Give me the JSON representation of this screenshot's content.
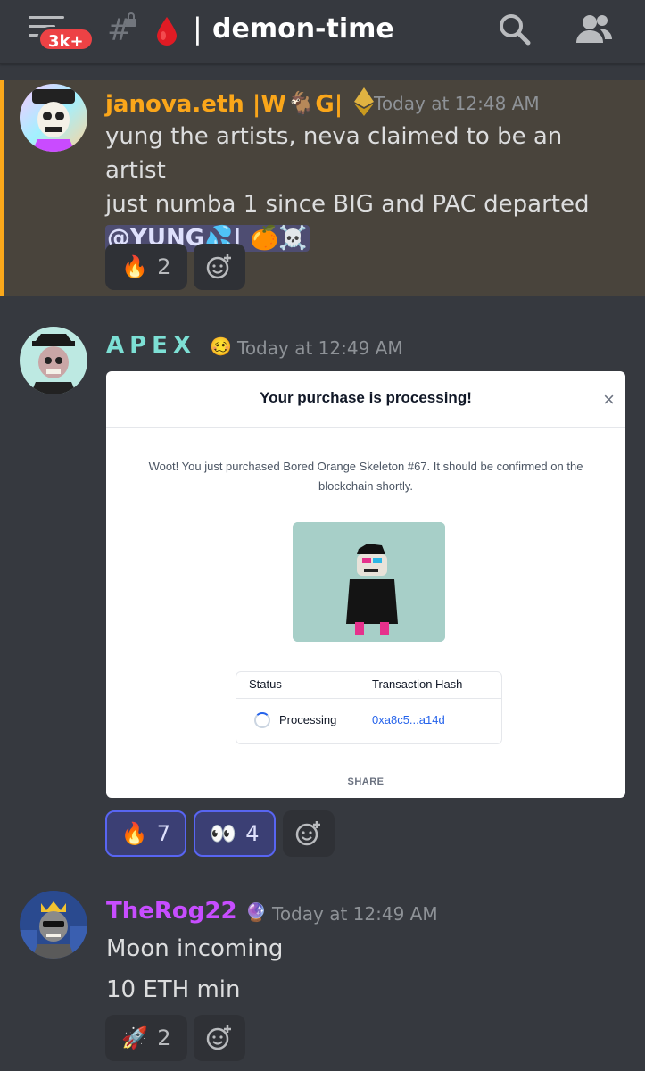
{
  "header": {
    "notification_badge": "3k+",
    "channel_name": "demon-time",
    "channel_emoji": "drop-of-blood"
  },
  "messages": [
    {
      "author": "janova.eth |W🐐G|",
      "author_color": "#faa61a",
      "author_badge_icon": "ethereum-icon",
      "timestamp": "Today at 12:48 AM",
      "lines": [
        "yung the artists, neva claimed to be an artist",
        "just numba 1 since BIG and PAC departed"
      ],
      "mention": "@YUNG💦| 🍊☠️",
      "reactions": [
        {
          "emoji": "🔥",
          "count": "2"
        }
      ]
    },
    {
      "author": "APEX",
      "author_color": "#7de0d5",
      "author_emoji": "🥴",
      "timestamp": "Today at 12:49 AM",
      "reactions": [
        {
          "emoji": "🔥",
          "count": "7"
        },
        {
          "emoji": "👀",
          "count": "4"
        }
      ],
      "embed": {
        "title": "Your purchase is processing!",
        "close": "×",
        "description": "Woot! You just purchased Bored Orange Skeleton #67. It should be confirmed on the blockchain shortly.",
        "table_headers": [
          "Status",
          "Transaction Hash"
        ],
        "status": "Processing",
        "tx_hash": "0xa8c5...a14d",
        "share": "SHARE"
      }
    },
    {
      "author": "TheRog22",
      "author_color": "#c74dff",
      "author_emoji": "🔮",
      "timestamp": "Today at 12:49 AM",
      "lines": [
        "Moon incoming",
        "10 ETH min"
      ],
      "reactions": [
        {
          "emoji": "🚀",
          "count": "2"
        }
      ]
    }
  ]
}
